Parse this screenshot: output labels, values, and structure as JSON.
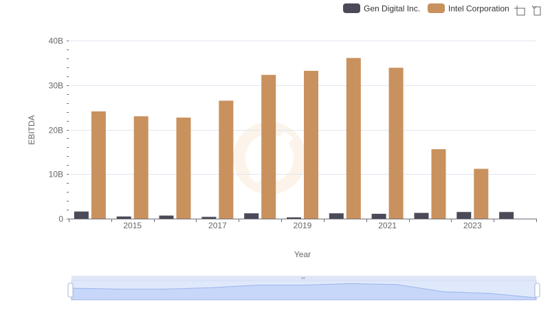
{
  "chart_data": {
    "type": "bar",
    "x": [
      2014,
      2015,
      2016,
      2017,
      2018,
      2019,
      2020,
      2021,
      2022,
      2023,
      2024
    ],
    "x_tick_labels": [
      "2015",
      "2017",
      "2019",
      "2021",
      "2023"
    ],
    "series": [
      {
        "name": "Gen Digital Inc.",
        "color": "#4a4a58",
        "values": [
          1.6,
          0.5,
          0.7,
          0.4,
          1.2,
          0.3,
          1.2,
          1.1,
          1.3,
          1.5,
          1.5
        ]
      },
      {
        "name": "Intel Corporation",
        "color": "#c9915e",
        "values": [
          24.1,
          23.0,
          22.7,
          26.5,
          32.3,
          33.2,
          36.1,
          33.9,
          15.6,
          11.2,
          null
        ]
      }
    ],
    "ylim": [
      0,
      40
    ],
    "y_ticks": [
      0,
      10,
      20,
      30,
      40
    ],
    "y_tick_labels": [
      "0",
      "10B",
      "20B",
      "30B",
      "40B"
    ],
    "xlabel": "Year",
    "ylabel": "EBITDA",
    "grid": true,
    "legend_position": "top-right",
    "zoom_slider": true
  },
  "toolbox": {
    "zoom_icon": "zoom-select-icon",
    "restore_icon": "restore-icon"
  }
}
